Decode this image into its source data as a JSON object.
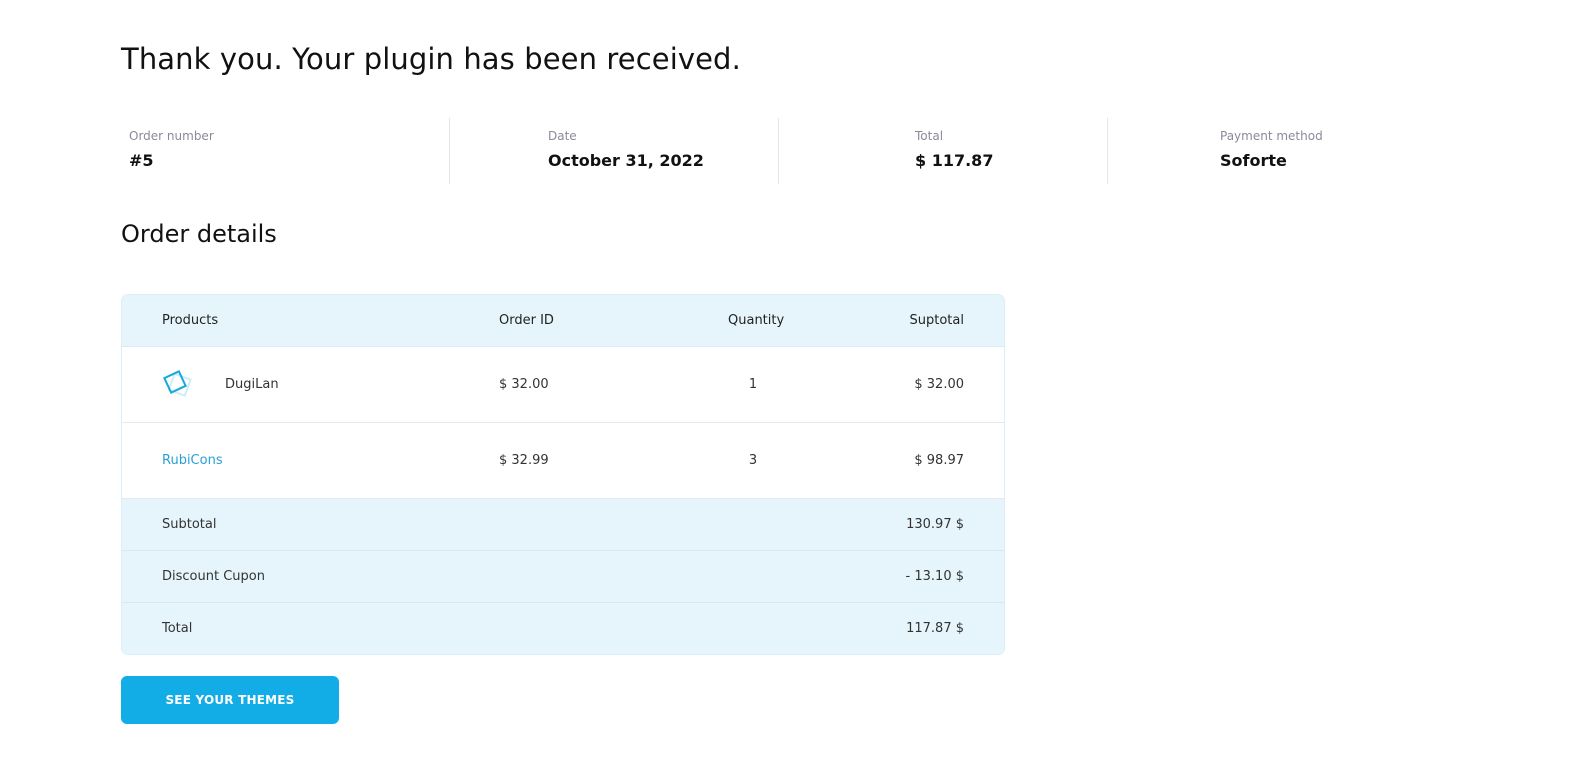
{
  "header": {
    "thanks_message": "Thank you. Your plugin has been received."
  },
  "overview": {
    "order_number_label": "Order number",
    "order_number": "#5",
    "date_label": "Date",
    "date": "October 31, 2022",
    "total_label": "Total",
    "total": "$ 117.87",
    "payment_label": "Payment method",
    "payment": "Soforte"
  },
  "details": {
    "title": "Order details",
    "columns": [
      "Products",
      "Order ID",
      "Quantity",
      "Suptotal"
    ],
    "rows": [
      {
        "product": "DugiLan",
        "icon": "diamond-logo-icon",
        "order_id": "$ 32.00",
        "quantity": "1",
        "subtotal": "$ 32.00"
      },
      {
        "product": "RubiCons",
        "order_id": "$ 32.99",
        "quantity": "3",
        "subtotal": "$ 98.97"
      }
    ],
    "summary": [
      {
        "label": "Subtotal",
        "value": "130.97 $"
      },
      {
        "label": "Discount Cupon",
        "value": "- 13.10 $"
      },
      {
        "label": "Total",
        "value": "117.87 $"
      }
    ]
  },
  "actions": {
    "see_themes_label": "SEE YOUR THEMES"
  },
  "colors": {
    "accent": "#12ade6",
    "table_header_bg": "#e6f5fc",
    "link": "#2a9fd6"
  }
}
